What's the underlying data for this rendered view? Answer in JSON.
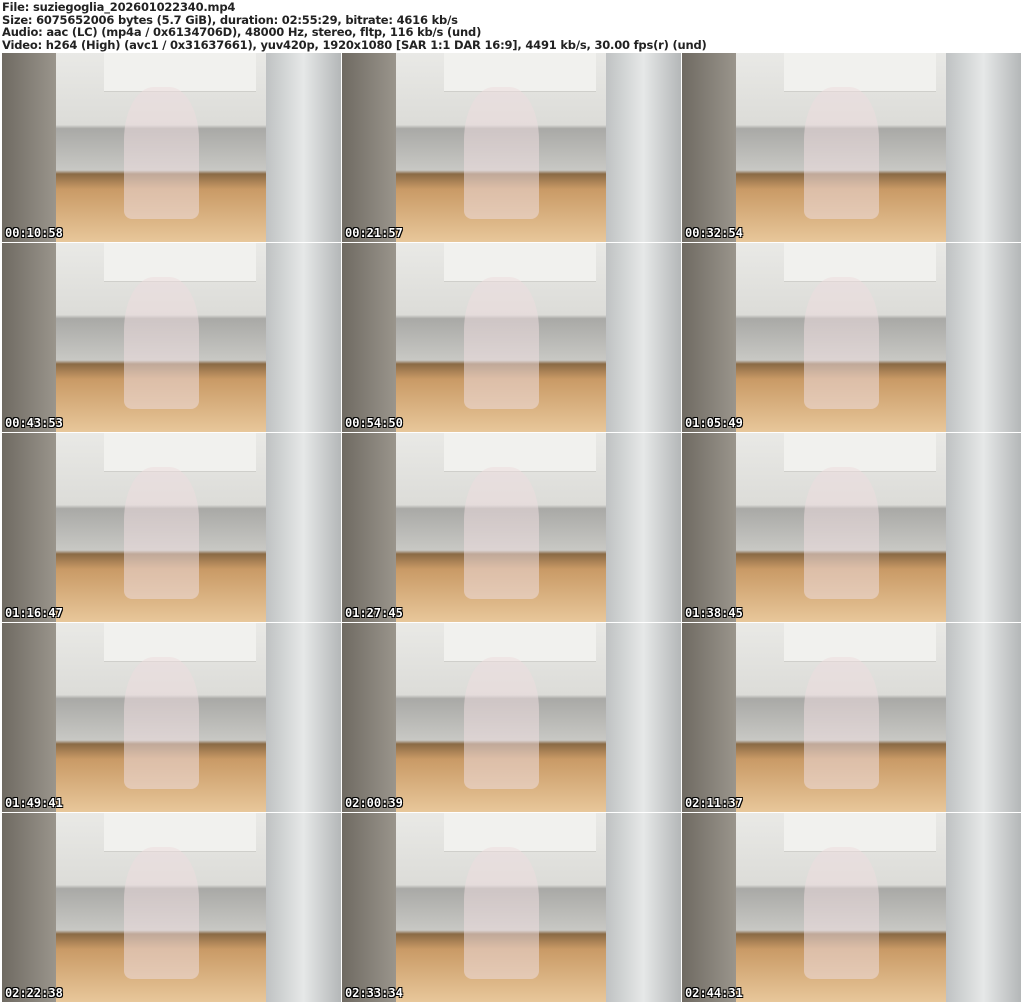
{
  "header": {
    "file": "File: suziegoglia_202601022340.mp4",
    "size": "Size: 6075652006 bytes (5.7 GiB), duration: 02:55:29, bitrate: 4616 kb/s",
    "audio": "Audio: aac (LC) (mp4a / 0x6134706D), 48000 Hz, stereo, fltp, 116 kb/s (und)",
    "video": "Video: h264 (High) (avc1 / 0x31637661), yuv420p, 1920x1080 [SAR 1:1 DAR 16:9], 4491 kb/s, 30.00 fps(r) (und)"
  },
  "thumbnails": [
    {
      "timestamp": "00:10:58"
    },
    {
      "timestamp": "00:21:57"
    },
    {
      "timestamp": "00:32:54"
    },
    {
      "timestamp": "00:43:53"
    },
    {
      "timestamp": "00:54:50"
    },
    {
      "timestamp": "01:05:49"
    },
    {
      "timestamp": "01:16:47"
    },
    {
      "timestamp": "01:27:45"
    },
    {
      "timestamp": "01:38:45"
    },
    {
      "timestamp": "01:49:41"
    },
    {
      "timestamp": "02:00:39"
    },
    {
      "timestamp": "02:11:37"
    },
    {
      "timestamp": "02:22:38"
    },
    {
      "timestamp": "02:33:34"
    },
    {
      "timestamp": "02:44:31"
    }
  ]
}
